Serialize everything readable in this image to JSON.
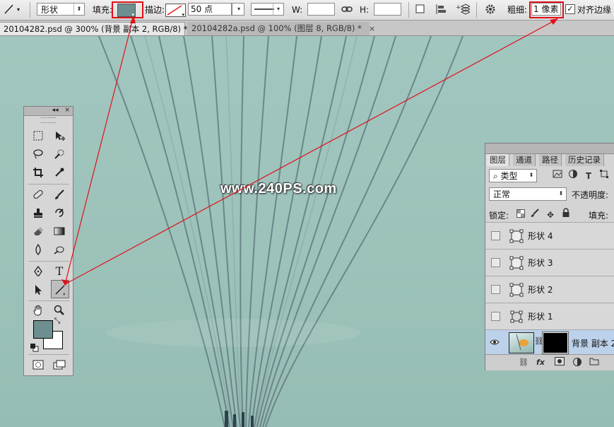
{
  "options_bar": {
    "mode_value": "形状",
    "fill_label": "填充:",
    "stroke_label": "描边:",
    "stroke_size_value": "50 点",
    "w_label": "W:",
    "h_label": "H:",
    "weight_label": "粗细:",
    "weight_value": "1 像素",
    "align_edges_label": "对齐边缘",
    "align_edges_checked": "✓",
    "fill_color": "#6e8f8f"
  },
  "tabs": [
    {
      "label": "20104282.psd @ 300% (背景 副本 2, RGB/8) *",
      "close": "×"
    },
    {
      "label": "20104282a.psd @ 100% (图层 8, RGB/8) *",
      "close": "×"
    }
  ],
  "watermark": "www.240PS.com",
  "tools_panel": {
    "collapse_label": "◂◂",
    "close_label": "×"
  },
  "layers_panel": {
    "tabs": [
      "图层",
      "通道",
      "路径",
      "历史记录"
    ],
    "filter_label": "类型",
    "blend_mode": "正常",
    "opacity_label": "不透明度:",
    "lock_label": "锁定:",
    "fill_label": "填充:",
    "layers": [
      {
        "name": "形状 4"
      },
      {
        "name": "形状 3"
      },
      {
        "name": "形状 2"
      },
      {
        "name": "形状 1"
      },
      {
        "name": "背景 副本 2"
      }
    ],
    "bottom_fx": "fx"
  }
}
